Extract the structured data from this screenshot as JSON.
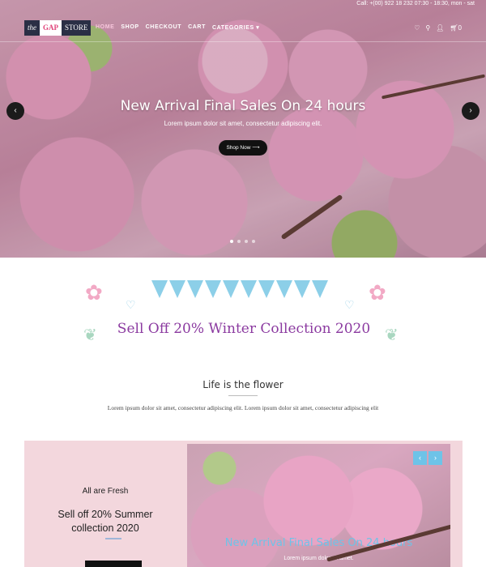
{
  "topbar": {
    "info": "Call: +(00) 922 18 232 07:30 - 18:30, mon - sat"
  },
  "logo": {
    "part1": "the",
    "part2": "GAP",
    "part3": "STORE"
  },
  "nav": {
    "items": [
      {
        "label": "HOME",
        "active": true
      },
      {
        "label": "SHOP",
        "active": false
      },
      {
        "label": "CHECKOUT",
        "active": false
      },
      {
        "label": "CART",
        "active": false
      },
      {
        "label": "CATEGORIES ▾",
        "active": false
      }
    ],
    "cart_count": "0"
  },
  "hero": {
    "title": "New Arrival Final Sales On 24 hours",
    "subtitle": "Lorem ipsum dolor sit amet, consectetur adipiscing elit.",
    "button_label": "Shop Now ⟶",
    "slide_count": 4,
    "active_slide": 1
  },
  "banner": {
    "text": "Sell Off 20% Winter Collection 2020"
  },
  "intro": {
    "title": "Life is the flower",
    "text": "Lorem ipsum dolor sit amet, consectetur adipiscing elit. Lorem ipsum dolor sit amet, consectetur adipiscing elit"
  },
  "promo": {
    "title": "All are Fresh",
    "subtitle": "Sell off 20% Summer collection 2020",
    "image_caption": "New Arrival Final Sales On 24 hours",
    "image_subcaption": "Lorem ipsum dolor sit amet."
  },
  "colors": {
    "banner_text": "#8b3aa0",
    "promo_bg": "#f3d7dd",
    "accent_blue": "#6ec3e8"
  }
}
